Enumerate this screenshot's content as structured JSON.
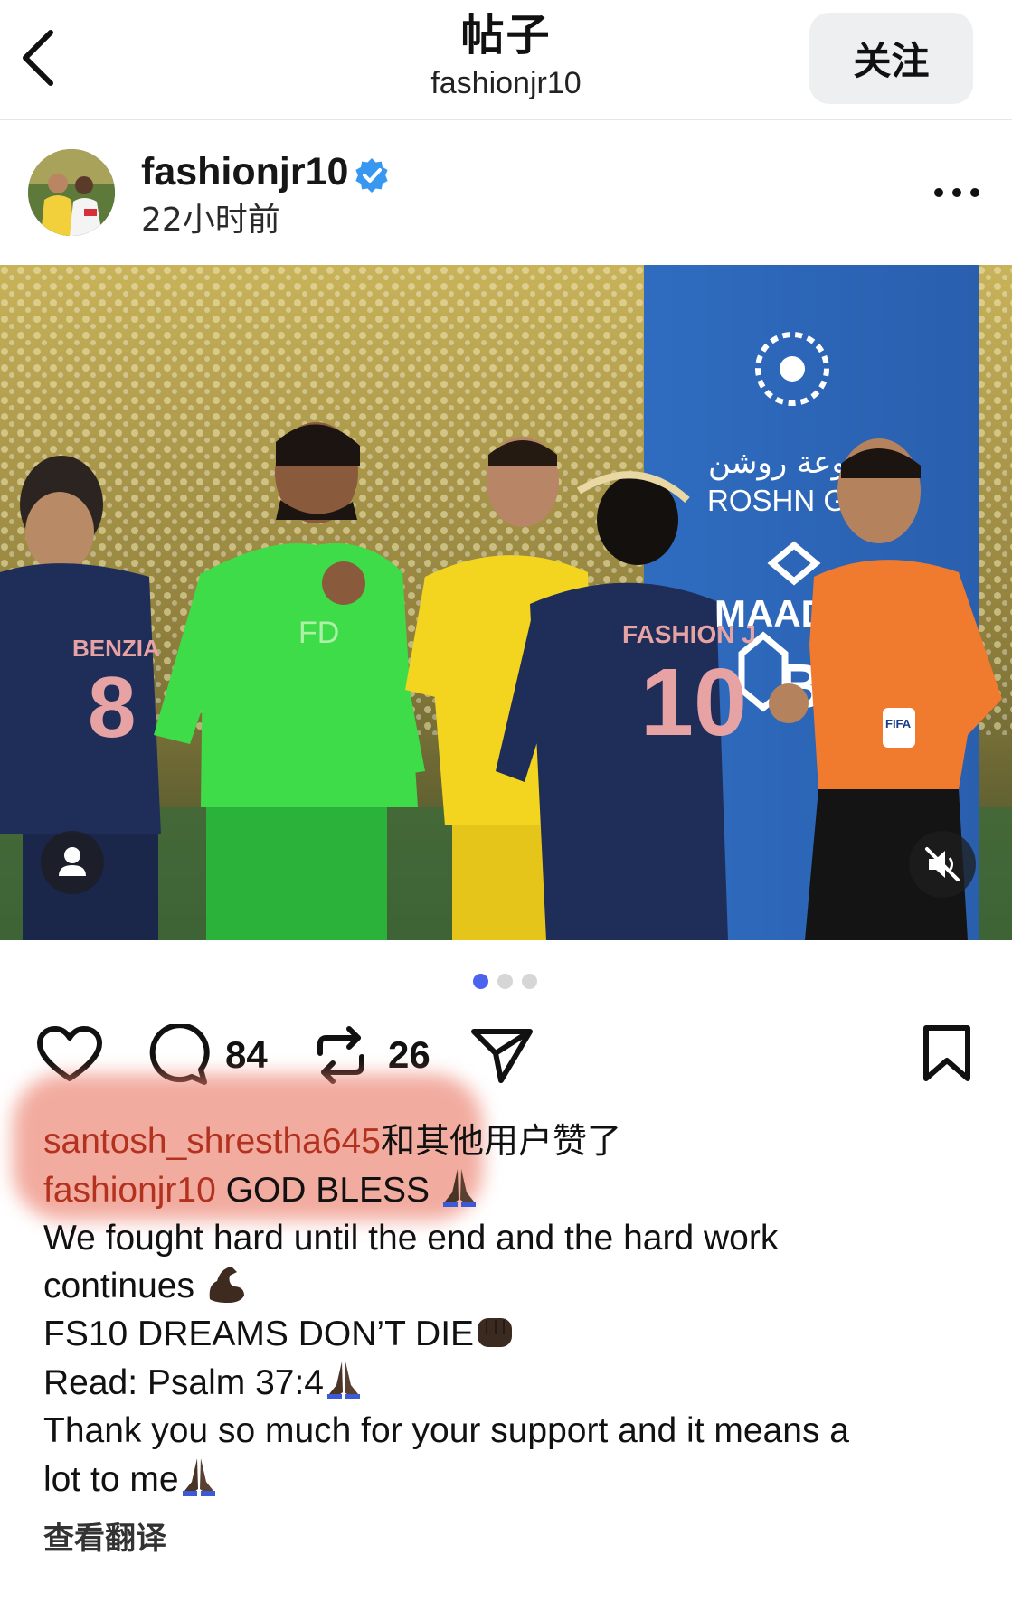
{
  "topbar": {
    "title": "帖子",
    "subtitle": "fashionjr10",
    "follow_label": "关注"
  },
  "post": {
    "username": "fashionjr10",
    "time_ago": "22小时前",
    "verified_color": "#3897f0",
    "image_dots": {
      "count": 3,
      "active_index": 0,
      "active_color": "#4a64f0"
    }
  },
  "image_text": {
    "sponsor1_ar": "مجموعة روشن",
    "sponsor1": "ROSHN GRO",
    "sponsor2": "MAADE",
    "sponsor3": "BS",
    "player1_name": "BENZIA",
    "player1_number": "8",
    "player2_name": "FASHION J",
    "player2_number": "10",
    "badge": "FIFA",
    "gk_shirt": "FD"
  },
  "actions": {
    "comments_count": "84",
    "reposts_count": "26"
  },
  "likes": {
    "liker": "santosh_shrestha645",
    "liked_suffix": "和其他用户赞了"
  },
  "caption": {
    "username": "fashionjr10",
    "line1": " GOD BLESS ",
    "line2": "We fought hard until the end and the hard work",
    "line3": "continues ",
    "line4": "FS10 DREAMS DON’T DIE",
    "line5": "Read: Psalm 37:4",
    "line6": "Thank you so much for your support and it means a",
    "line7": "lot to me"
  },
  "translate_label": "查看翻译"
}
